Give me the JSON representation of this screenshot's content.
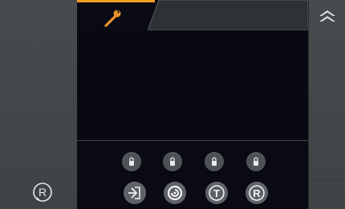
{
  "colors": {
    "accent": "#f0a020",
    "panel": "#454a4c",
    "display": "#0a0a14",
    "button": "#5e6266",
    "icon": "#f2f2f2"
  },
  "tabs": [
    {
      "icon": "wrench-icon",
      "active": true
    },
    {
      "icon": "",
      "active": false
    }
  ],
  "left_panel": {
    "reset_icon": "registered-circle-icon",
    "reset_label": "R"
  },
  "right_panel": {
    "collapse_icon": "double-chevron-up-icon"
  },
  "slot_buttons": [
    {
      "icon": "lock-icon"
    },
    {
      "icon": "lock-icon"
    },
    {
      "icon": "lock-icon"
    },
    {
      "icon": "lock-icon"
    }
  ],
  "action_buttons": [
    {
      "icon": "login-arrow-icon",
      "label": ""
    },
    {
      "icon": "spiral-icon",
      "label": ""
    },
    {
      "icon": "t-circle-icon",
      "label": "T"
    },
    {
      "icon": "r-circle-icon",
      "label": "R"
    }
  ]
}
